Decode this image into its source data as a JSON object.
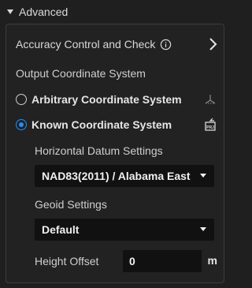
{
  "section": {
    "title": "Advanced"
  },
  "accuracy": {
    "label": "Accuracy Control and Check"
  },
  "output": {
    "heading": "Output Coordinate System",
    "options": [
      {
        "label": "Arbitrary Coordinate System",
        "selected": false,
        "icon": "axes-icon"
      },
      {
        "label": "Known Coordinate System",
        "selected": true,
        "icon": "prj-file-icon"
      }
    ]
  },
  "horizontal": {
    "label": "Horizontal Datum Settings",
    "value": "NAD83(2011) / Alabama East"
  },
  "geoid": {
    "label": "Geoid Settings",
    "value": "Default"
  },
  "height": {
    "label": "Height Offset",
    "value": "0",
    "unit": "m"
  },
  "colors": {
    "accent": "#1e90ff",
    "background": "#1f1f1f",
    "field": "#111111"
  }
}
